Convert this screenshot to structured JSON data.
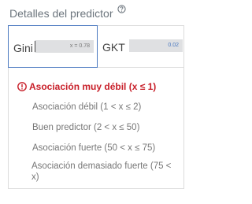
{
  "header": {
    "title": "Detalles del predictor",
    "help_icon": "question-circle-icon"
  },
  "tabs": [
    {
      "label": "Gini",
      "value_text": "x = 0.78",
      "value": 0.78,
      "selected": true
    },
    {
      "label": "GKT",
      "value_text": "0.02",
      "value": 0.02,
      "selected": false
    }
  ],
  "levels": [
    {
      "label": "Asociación muy débil (x ≤ 1)",
      "active": true,
      "icon": "exclamation-circle-icon"
    },
    {
      "label": "Asociación débil (1 < x ≤ 2)",
      "active": false
    },
    {
      "label": "Buen predictor (2 < x ≤ 50)",
      "active": false
    },
    {
      "label": "Asociación fuerte (50 < x ≤ 75)",
      "active": false
    },
    {
      "label_line1": "Asociación demasiado fuerte (75 <",
      "label_line2": "x)",
      "active": false
    }
  ],
  "colors": {
    "accent": "#4a78c0",
    "danger": "#c8202a",
    "muted": "#777777"
  }
}
